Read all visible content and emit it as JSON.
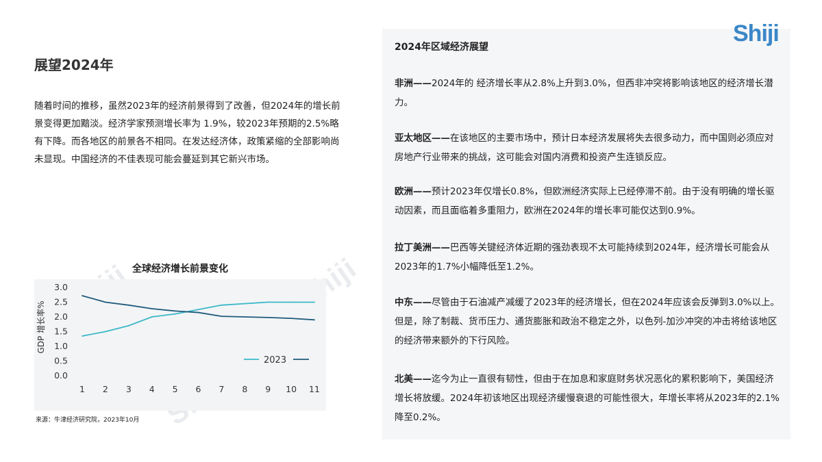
{
  "logo": "Shiji",
  "watermark": "Shiji",
  "left": {
    "title": "展望2024年",
    "intro": "随着时间的推移，虽然2023年的经济前景得到了改善，但2024年的增长前景变得更加黯淡。经济学家预测增长率为 1.9%，较2023年预期的2.5%略有下降。而各地区的前景各不相同。在发达经济体，政策紧缩的全部影响尚未显现。中国经济的不佳表现可能会蔓延到其它新兴市场。"
  },
  "chart": {
    "title": "全球经济增长前景变化",
    "source": "来源：牛津经济研究院，2023年10月"
  },
  "chart_data": {
    "type": "line",
    "title": "全球经济增长前景变化",
    "xlabel": "",
    "ylabel": "GDP 增长率%",
    "x": [
      1,
      2,
      3,
      4,
      5,
      6,
      7,
      8,
      9,
      10,
      11
    ],
    "ylim": [
      0,
      3.0
    ],
    "yticks": [
      "0.0",
      "0.5",
      "1.0",
      "1.5",
      "2.0",
      "2.5",
      "3.0"
    ],
    "grid": false,
    "legend_position": "bottom-right",
    "series": [
      {
        "name": "2023",
        "color": "#3ab8c8",
        "values": [
          1.35,
          1.5,
          1.7,
          2.0,
          2.1,
          2.25,
          2.4,
          2.45,
          2.5,
          2.5,
          2.5
        ]
      },
      {
        "name": "",
        "color": "#1f5a7a",
        "values": [
          2.72,
          2.5,
          2.4,
          2.28,
          2.2,
          2.15,
          2.02,
          2.0,
          1.98,
          1.95,
          1.9
        ]
      }
    ]
  },
  "right": {
    "title": "2024年区域经济展望",
    "regions": [
      {
        "name": "非洲——",
        "text": "2024年的 经济增长率从2.8%上升到3.0%，但西非冲突将影响该地区的经济增长潜力。"
      },
      {
        "name": "亚太地区——",
        "text": "在该地区的主要市场中，预计日本经济发展将失去很多动力，而中国则必须应对房地产行业带来的挑战，这可能会对国内消费和投资产生连锁反应。"
      },
      {
        "name": "欧洲——",
        "text": "预计2023年仅增长0.8%，但欧洲经济实际上已经停滞不前。由于没有明确的增长驱动因素，而且面临着多重阻力，欧洲在2024年的增长率可能仅达到0.9%。"
      },
      {
        "name": "拉丁美洲——",
        "text": "巴西等关键经济体近期的强劲表现不太可能持续到2024年，经济增长可能会从2023年的1.7%小幅降低至1.2%。"
      },
      {
        "name": "中东——",
        "text": "尽管由于石油减产减缓了2023年的经济增长，但在2024年应该会反弹到3.0%以上。但是，除了制裁、货币压力、通货膨胀和政治不稳定之外，以色列-加沙冲突的冲击将给该地区的经济带来额外的下行风险。"
      },
      {
        "name": "北美——",
        "text": "迄今为止一直很有韧性，但由于在加息和家庭财务状况恶化的累积影响下，美国经济增长将放缓。2024年初该地区出现经济缓慢衰退的可能性很大，年增长率将从2023年的2.1%降至0.2%。"
      }
    ]
  }
}
